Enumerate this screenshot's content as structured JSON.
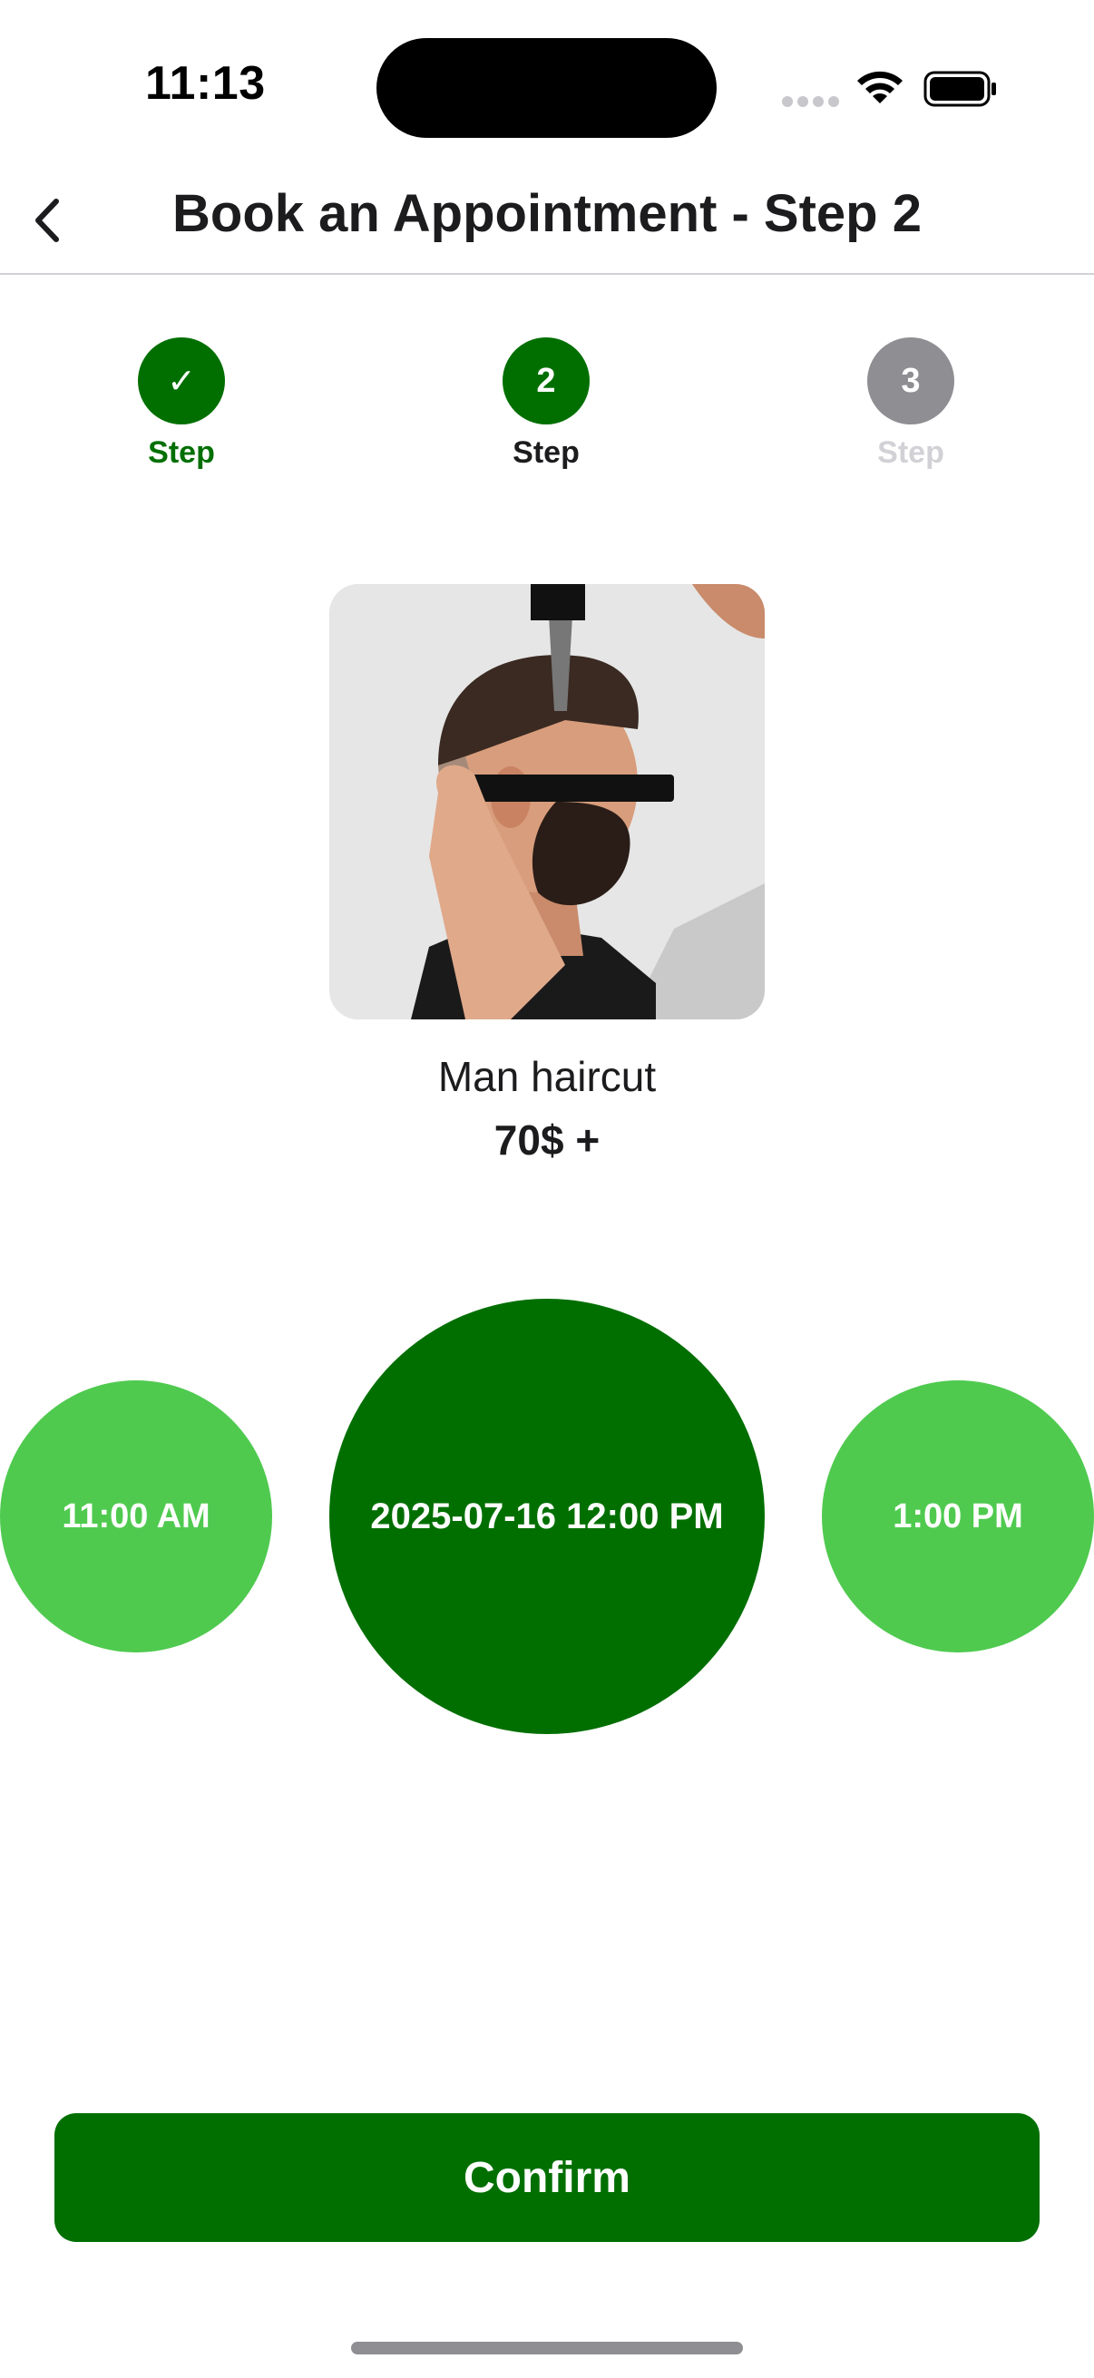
{
  "colors": {
    "primary_green": "#006f00",
    "light_green": "#4fca4f",
    "inactive_gray": "#8e8e93",
    "inactive_text": "#d1d1d6"
  },
  "status_bar": {
    "time": "11:13",
    "icons": [
      "signal-dots-icon",
      "wifi-icon",
      "battery-icon"
    ]
  },
  "nav": {
    "back_icon": "chevron-left-icon",
    "title": "Book an Appointment - Step 2"
  },
  "steps": [
    {
      "symbol": "✓",
      "label": "Step",
      "state": "completed"
    },
    {
      "symbol": "2",
      "label": "Step",
      "state": "current"
    },
    {
      "symbol": "3",
      "label": "Step",
      "state": "upcoming"
    }
  ],
  "service": {
    "name": "Man haircut",
    "price": "70$ +"
  },
  "time_slots": {
    "previous": "11:00 AM",
    "selected": "2025-07-16 12:00 PM",
    "next": "1:00 PM"
  },
  "confirm_label": "Confirm"
}
